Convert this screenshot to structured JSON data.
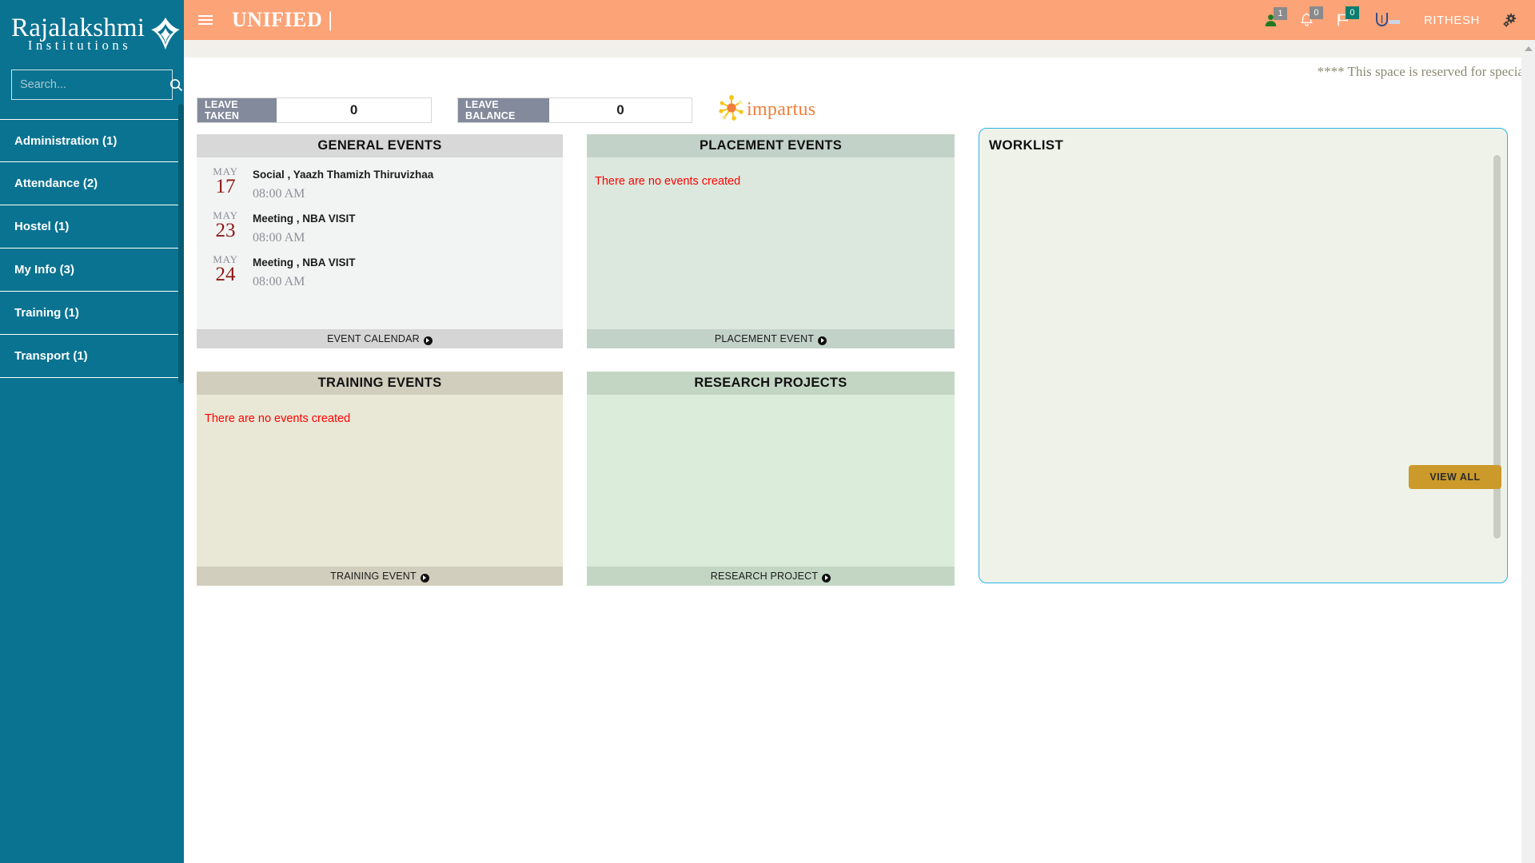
{
  "sidebar": {
    "logo": {
      "main": "Rajalakshmi",
      "sub": "Institutions"
    },
    "search": {
      "placeholder": "Search...",
      "value": ""
    },
    "items": [
      {
        "label": "Administration (1)"
      },
      {
        "label": "Attendance (2)"
      },
      {
        "label": "Hostel (1)"
      },
      {
        "label": "My Info (3)"
      },
      {
        "label": "Training (1)"
      },
      {
        "label": "Transport (1)"
      }
    ]
  },
  "topbar": {
    "title": "UNIFIED |",
    "user_name": "RITHESH",
    "badges": {
      "user_count": "1",
      "bell_count": "0",
      "flag_count": "0"
    },
    "colors": {
      "bar": "#fca377",
      "badge_grey": "#8a8a8a",
      "badge_teal": "#0b7d6e"
    }
  },
  "marquee": {
    "text": "**** This space is reserved for specia"
  },
  "leave": {
    "taken_label": "LEAVE TAKEN",
    "taken_value": "0",
    "balance_label": "LEAVE BALANCE",
    "balance_value": "0"
  },
  "impartus": {
    "name": "impartus"
  },
  "panels": {
    "general": {
      "title": "GENERAL EVENTS",
      "footer": "EVENT CALENDAR",
      "events": [
        {
          "month": "MAY",
          "day": "17",
          "title": "Social , Yaazh Thamizh Thiruvizhaa",
          "time": "08:00 AM"
        },
        {
          "month": "MAY",
          "day": "23",
          "title": "Meeting , NBA VISIT",
          "time": "08:00 AM"
        },
        {
          "month": "MAY",
          "day": "24",
          "title": "Meeting , NBA VISIT",
          "time": "08:00 AM"
        }
      ]
    },
    "placement": {
      "title": "PLACEMENT EVENTS",
      "footer": "PLACEMENT EVENT",
      "empty_message": "There are no events created"
    },
    "training": {
      "title": "TRAINING EVENTS",
      "footer": "TRAINING EVENT",
      "empty_message": "There are no events created"
    },
    "research": {
      "title": "RESEARCH PROJECTS",
      "footer": "RESEARCH PROJECT",
      "empty_message": ""
    }
  },
  "worklist": {
    "title": "WORKLIST",
    "view_all_label": "VIEW ALL",
    "accent_color": "#29b6e8",
    "button_color": "#cb9a2a"
  }
}
